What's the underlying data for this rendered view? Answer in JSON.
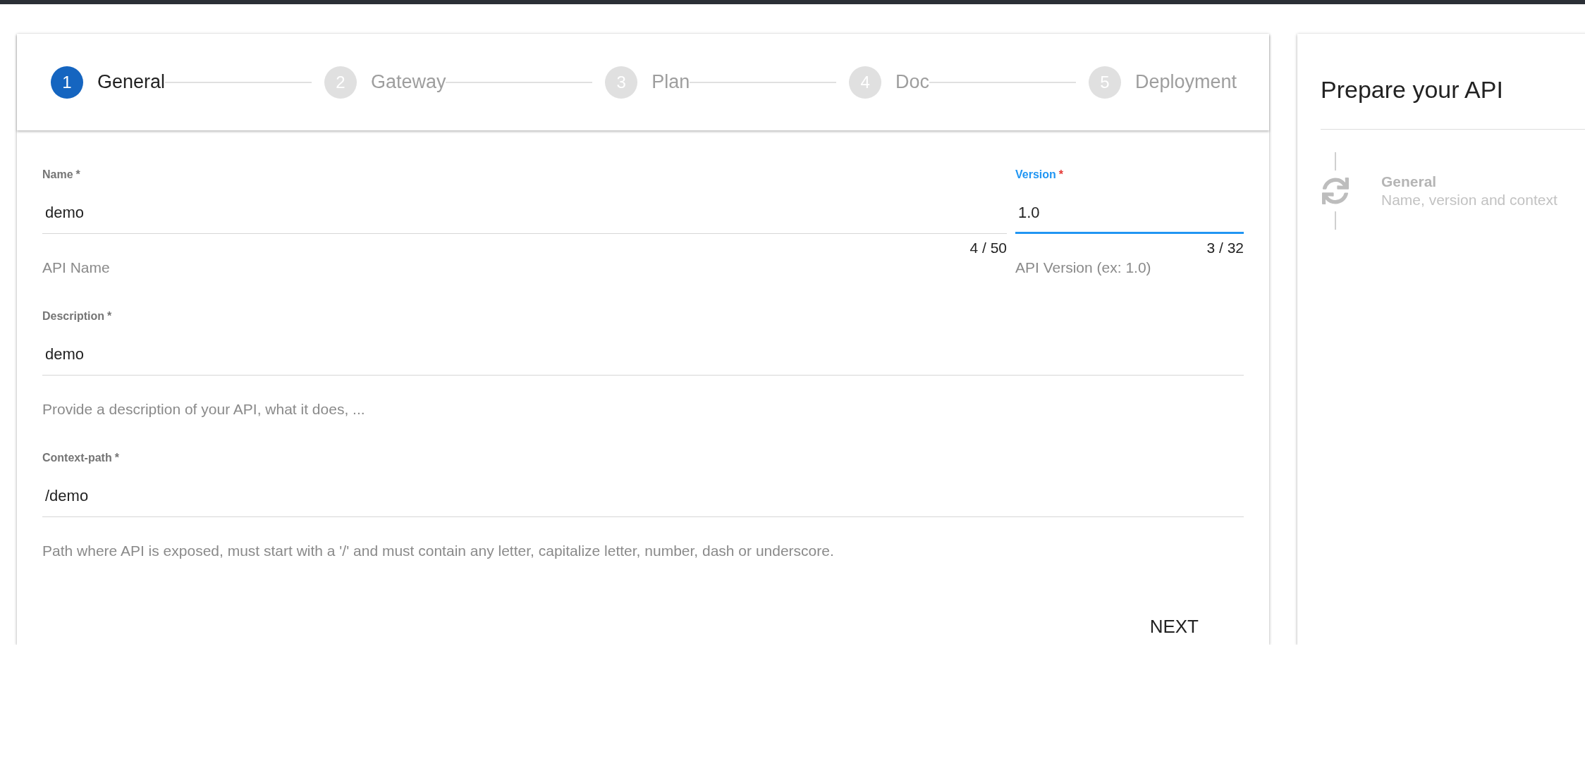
{
  "stepper": {
    "steps": [
      {
        "number": "1",
        "label": "General",
        "selected": true
      },
      {
        "number": "2",
        "label": "Gateway",
        "selected": false
      },
      {
        "number": "3",
        "label": "Plan",
        "selected": false
      },
      {
        "number": "4",
        "label": "Doc",
        "selected": false
      },
      {
        "number": "5",
        "label": "Deployment",
        "selected": false
      }
    ]
  },
  "form": {
    "rows": [
      [
        {
          "label": "Name",
          "required_mark": "*",
          "value": "demo",
          "counter": "4 / 50",
          "hint": "API Name",
          "focused": false
        },
        {
          "label": "Version",
          "required_mark": "*",
          "value": "1.0",
          "counter": "3 / 32",
          "hint": "API Version (ex: 1.0)",
          "focused": true
        }
      ],
      [
        {
          "label": "Description",
          "required_mark": "*",
          "value": "demo",
          "hint": "Provide a description of your API, what it does, ...",
          "focused": false
        }
      ],
      [
        {
          "label": "Context-path",
          "required_mark": "*",
          "value": "/demo",
          "hint": "Path where API is exposed, must start with a '/' and must contain any letter, capitalize letter, number, dash or underscore.",
          "focused": false
        }
      ]
    ],
    "next_button": "NEXT"
  },
  "side_panel": {
    "title": "Prepare your API",
    "steps": [
      {
        "title": "General",
        "subtitle": "Name, version and context"
      }
    ]
  }
}
